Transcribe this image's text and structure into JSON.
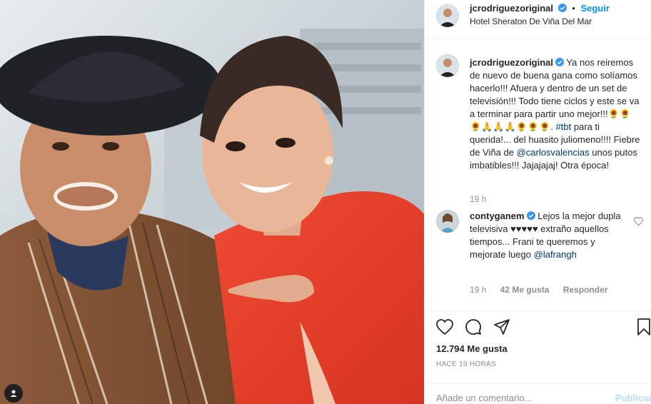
{
  "post": {
    "author": "jcrodriguezoriginal",
    "follow_label": "Seguir",
    "location": "Hotel Sheraton De Viña Del Mar",
    "more_label": "···"
  },
  "caption": {
    "author": "jcrodriguezoriginal",
    "text_1": "Ya nos reiremos de nuevo de buena gana como solíamos hacerlo!!! Afuera y dentro de un set de televisión!!! Todo tiene ciclos y este se va a terminar para partir uno mejor!!!🌻🌻🌻🙏🙏🙏🌻🌻🌻.",
    "hashtag": "#tbt",
    "text_2": "para ti querida!... del huasito juliomeno!!!! Fiebre de Viña de",
    "mention": "@carlosvalencias",
    "text_3": "unos putos imbatibles!!! Jajajajaj! Otra época!",
    "time": "19 h"
  },
  "comment": {
    "author": "contyganem",
    "text": "Lejos la mejor dupla televisiva ♥♥♥♥♥ extraño aquellos tiempos... Frani te queremos y mejorate luego",
    "mention": "@lafrangh",
    "time": "19 h",
    "likes": "42 Me gusta",
    "reply_label": "Responder"
  },
  "actions": {
    "likes_count": "12.794 Me gusta",
    "posted_ago": "HACE 19 HORAS"
  },
  "composer": {
    "placeholder": "Añade un comentario...",
    "publish_label": "Publicar"
  },
  "colors": {
    "accent": "#0095f6",
    "link": "#00376b",
    "muted": "#8e8e8e",
    "publish_disabled": "#b2dffc"
  }
}
